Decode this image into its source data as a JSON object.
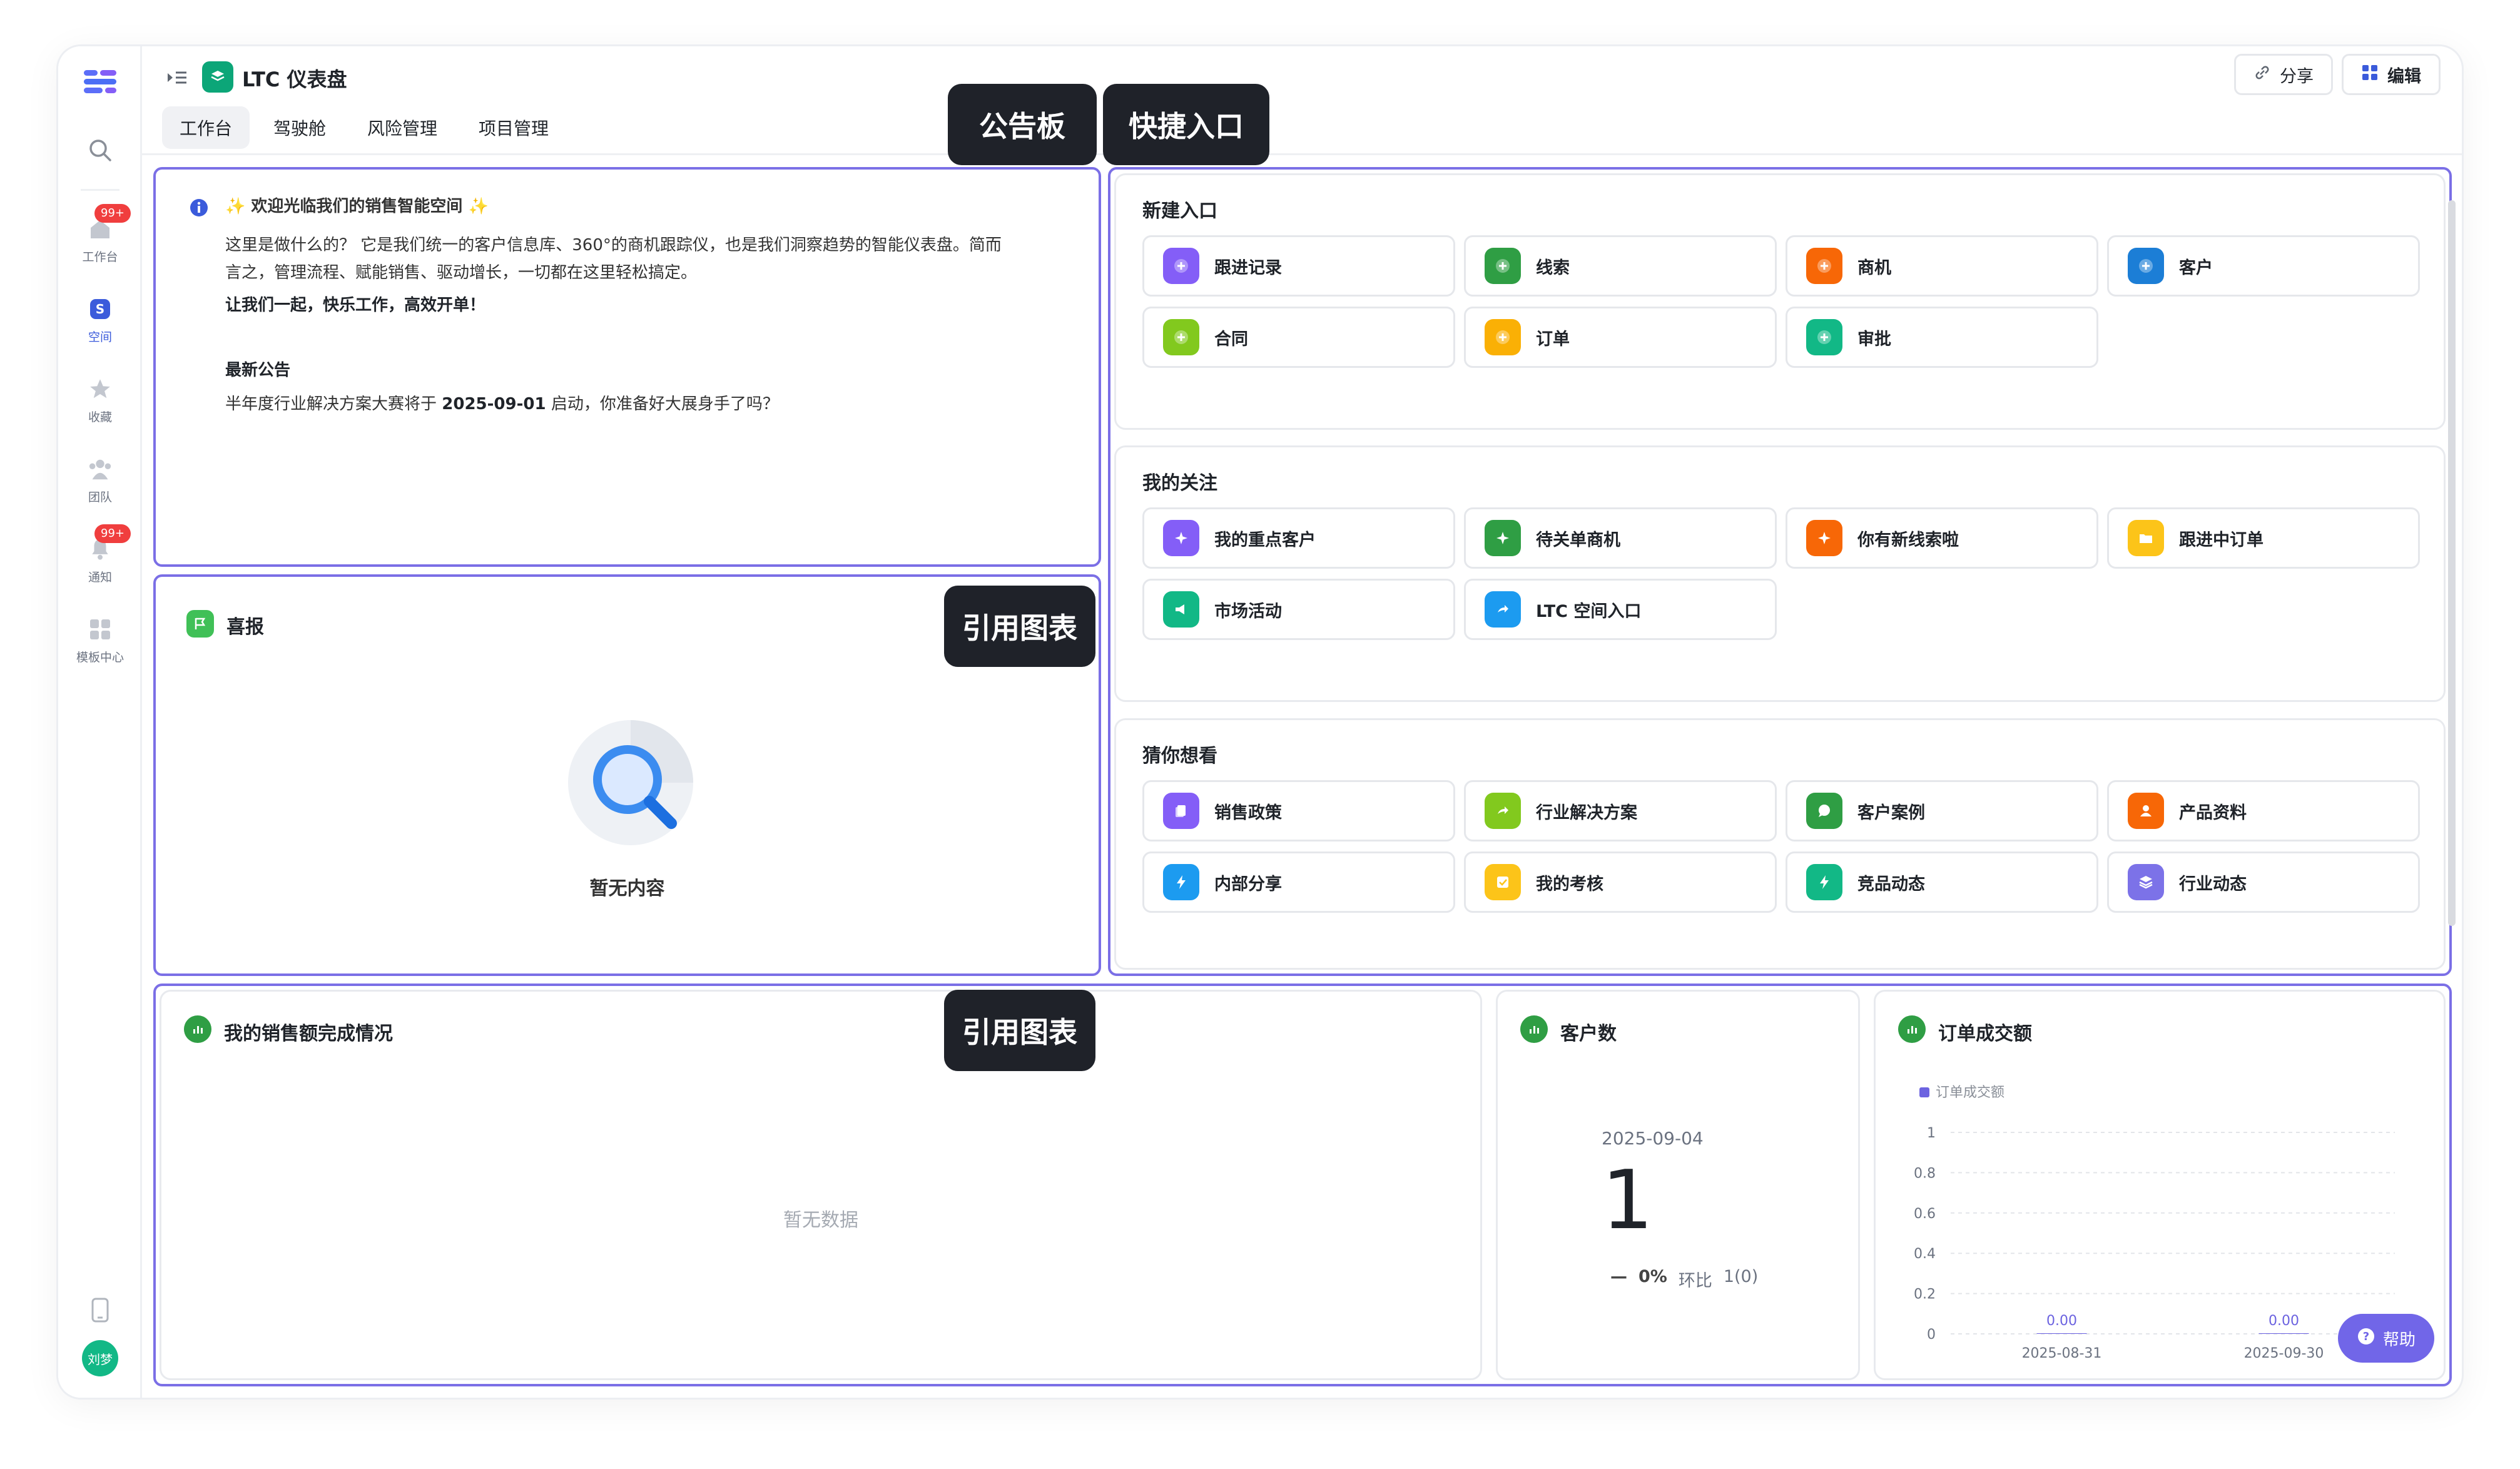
{
  "rail": {
    "items": [
      {
        "label": ""
      },
      {
        "label": "工作台",
        "badge": "99+"
      },
      {
        "label": "空间"
      },
      {
        "label": "收藏"
      },
      {
        "label": "团队"
      },
      {
        "label": "通知",
        "badge": "99+"
      },
      {
        "label": "模板中心"
      }
    ],
    "avatar": "刘梦"
  },
  "header": {
    "title": "LTC 仪表盘",
    "tabs": [
      {
        "label": "工作台"
      },
      {
        "label": "驾驶舱"
      },
      {
        "label": "风险管理"
      },
      {
        "label": "项目管理"
      }
    ],
    "share_label": "分享",
    "edit_label": "编辑"
  },
  "callouts": {
    "notice": "公告板",
    "quick": "快捷入口",
    "chart_ref_1": "引用图表",
    "chart_ref_2": "引用图表"
  },
  "notice": {
    "headline": "✨ 欢迎光临我们的销售智能空间 ✨",
    "line1": "这里是做什么的？ 它是我们统一的客户信息库、360°的商机跟踪仪，也是我们洞察趋势的智能仪表盘。简而",
    "line2": "言之，管理流程、赋能销售、驱动增长，一切都在这里轻松搞定。",
    "line3": "让我们一起，快乐工作，高效开单！",
    "latest_title": "最新公告",
    "latest_pre": "半年度行业解决方案大赛将于 ",
    "latest_date": "2025-09-01",
    "latest_post": " 启动，你准备好大展身手了吗？"
  },
  "xibao": {
    "title": "喜报",
    "empty": "暂无内容"
  },
  "quick": {
    "new_title": "新建入口",
    "new_items": [
      {
        "label": "跟进记录",
        "color": "#845ef7"
      },
      {
        "label": "线索",
        "color": "#2f9e44"
      },
      {
        "label": "商机",
        "color": "#f76707"
      },
      {
        "label": "客户",
        "color": "#1c7ed6"
      },
      {
        "label": "合同",
        "color": "#82c91e"
      },
      {
        "label": "订单",
        "color": "#fab005"
      },
      {
        "label": "审批",
        "color": "#12b886"
      }
    ],
    "follow_title": "我的关注",
    "follow_items": [
      {
        "label": "我的重点客户",
        "color": "#845ef7"
      },
      {
        "label": "待关单商机",
        "color": "#2f9e44"
      },
      {
        "label": "你有新线索啦",
        "color": "#f76707"
      },
      {
        "label": "跟进中订单",
        "color": "#fcc419"
      },
      {
        "label": "市场活动",
        "color": "#12b886"
      },
      {
        "label": "LTC 空间入口",
        "color": "#1c9bf0"
      }
    ],
    "guess_title": "猜你想看",
    "guess_items": [
      {
        "label": "销售政策",
        "color": "#845ef7"
      },
      {
        "label": "行业解决方案",
        "color": "#82c91e"
      },
      {
        "label": "客户案例",
        "color": "#2f9e44"
      },
      {
        "label": "产品资料",
        "color": "#f76707"
      },
      {
        "label": "内部分享",
        "color": "#1c9bf0"
      },
      {
        "label": "我的考核",
        "color": "#fcc419"
      },
      {
        "label": "竞品动态",
        "color": "#12b886"
      },
      {
        "label": "行业动态",
        "color": "#7c72e8"
      }
    ]
  },
  "sales": {
    "title": "我的销售额完成情况",
    "empty": "暂无数据"
  },
  "customers": {
    "title": "客户数",
    "date": "2025-09-04",
    "value": "1",
    "change_pct": "0%",
    "compare_label": "环比",
    "compare_value": "1(0)"
  },
  "orders": {
    "title": "订单成交额"
  },
  "chart_data": {
    "type": "bar",
    "categories": [
      "2025-08-31",
      "2025-09-30"
    ],
    "series": [
      {
        "name": "订单成交额",
        "values": [
          0,
          0
        ]
      }
    ],
    "data_labels": [
      "0.00",
      "0.00"
    ],
    "ylim": [
      0,
      1
    ],
    "yticks": [
      "0",
      "0.2",
      "0.4",
      "0.6",
      "0.8",
      "1"
    ],
    "grid": true,
    "legend": "top-left",
    "color": "#6c63e0"
  },
  "help_label": "帮助"
}
